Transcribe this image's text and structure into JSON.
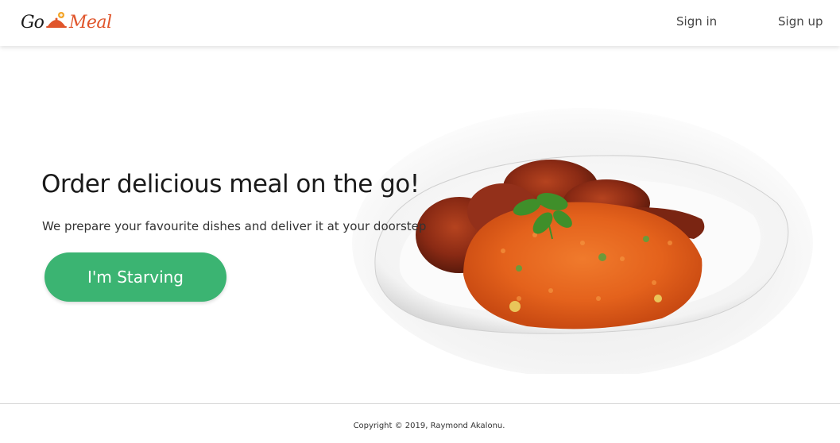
{
  "header": {
    "logo": {
      "part1": "Go",
      "part2": "Meal",
      "icon": "cloche-icon"
    },
    "nav": {
      "signin": "Sign in",
      "signup": "Sign up"
    }
  },
  "hero": {
    "title": "Order delicious meal on the go!",
    "subtitle": "We prepare your favourite dishes and deliver it at your doorstep",
    "cta_label": "I'm Starving",
    "image": "jollof-rice-and-chicken-plate"
  },
  "footer": {
    "copyright": "Copyright © 2019, Raymond Akalonu."
  },
  "colors": {
    "brand_orange": "#e0552b",
    "cta_green": "#3bb472"
  }
}
